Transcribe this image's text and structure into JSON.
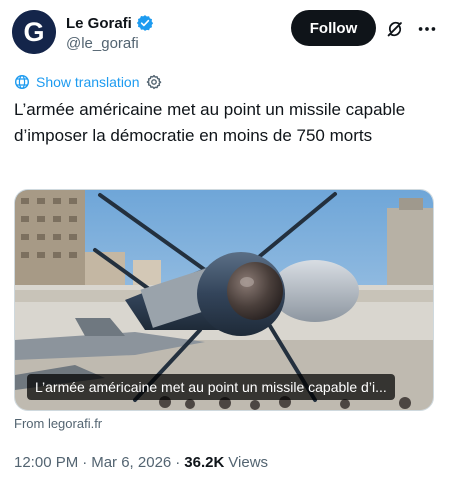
{
  "author": {
    "display_name": "Le Gorafi",
    "handle": "@le_gorafi",
    "avatar_letter": "G",
    "verified": true
  },
  "actions": {
    "follow_label": "Follow",
    "grok_icon": "grok-icon",
    "more_icon": "more-icon"
  },
  "translation": {
    "label": "Show translation"
  },
  "tweet": {
    "text": "L’armée américaine met au point un missile capable d’imposer la démocratie en moins de 750 morts"
  },
  "media": {
    "caption": "L’armée américaine met au point un missile capable d’i...",
    "source": "From legorafi.fr"
  },
  "meta": {
    "time": "12:00 PM",
    "date": "Mar 6, 2026",
    "separator": "·",
    "views_count": "36.2K",
    "views_label": "Views"
  },
  "colors": {
    "accent": "#1d9bf0",
    "text": "#0f1419",
    "secondary": "#536471",
    "avatar_bg": "#14254a"
  }
}
